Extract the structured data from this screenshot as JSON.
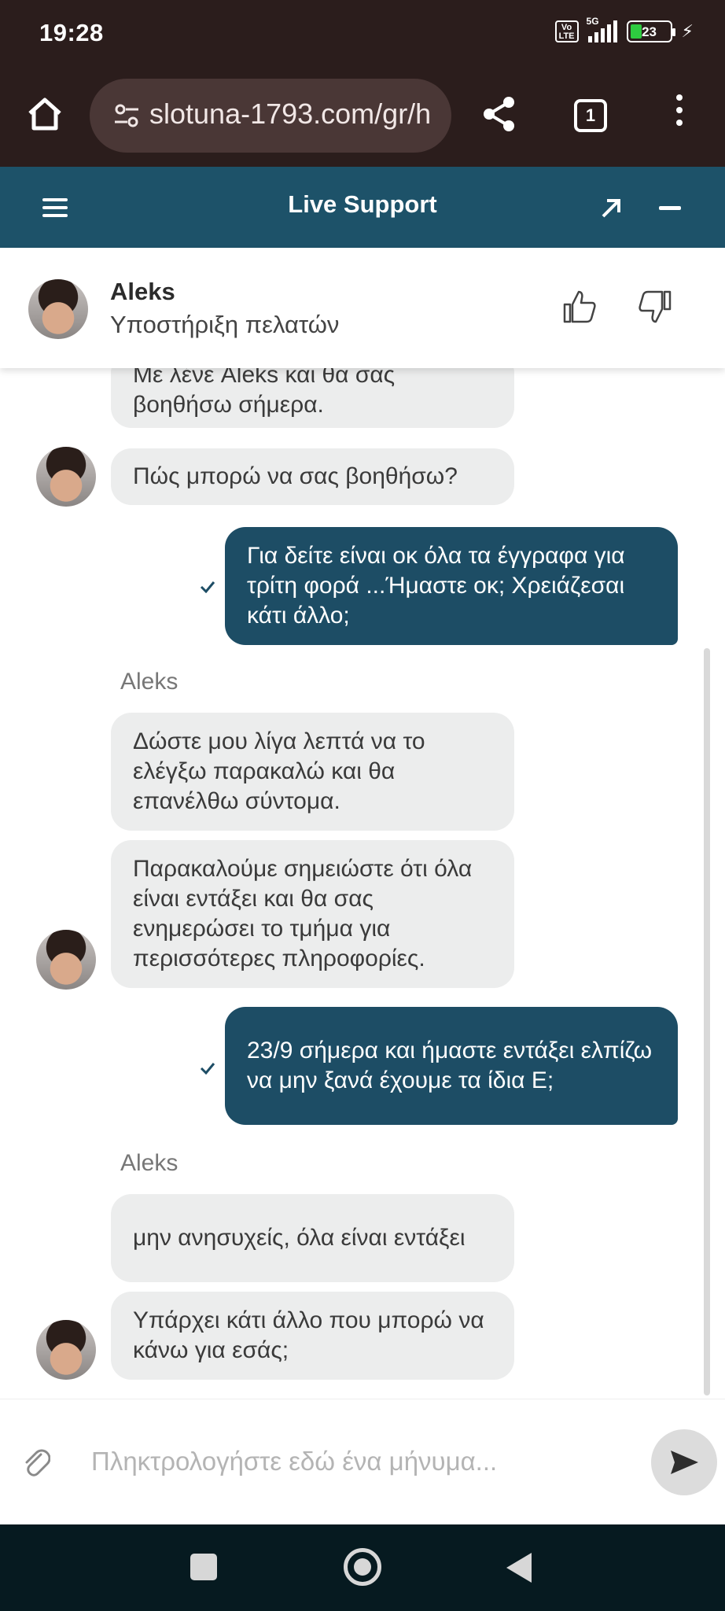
{
  "status_bar": {
    "time": "19:28",
    "volte": "Vo LTE",
    "network": "5G",
    "battery": "23"
  },
  "browser": {
    "url": "slotuna-1793.com/gr/h",
    "tab_count": "1"
  },
  "chat_header": {
    "title": "Live Support"
  },
  "agent": {
    "name": "Aleks",
    "role": "Υποστήριξη πελατών"
  },
  "messages": [
    {
      "from": "agent",
      "text": "Με λένε Aleks και θα σας βοηθήσω σήμερα."
    },
    {
      "from": "agent",
      "text": "Πώς μπορώ να σας βοηθήσω?"
    },
    {
      "from": "user",
      "text": "Για δείτε είναι οκ όλα τα έγγραφα για τρίτη φορά ...Ήμαστε οκ; Χρειάζεσαι κάτι άλλο;"
    },
    {
      "from": "agent",
      "sender": "Aleks",
      "text": "Δώστε μου λίγα λεπτά να το ελέγξω παρακαλώ και θα επανέλθω σύντομα."
    },
    {
      "from": "agent",
      "text": "Παρακαλούμε σημειώστε ότι όλα είναι εντάξει και θα σας ενημερώσει το τμήμα για περισσότερες πληροφορίες."
    },
    {
      "from": "user",
      "text": "23/9 σήμερα και ήμαστε εντάξει ελπίζω να μην ξανά έχουμε τα ίδια Ε;"
    },
    {
      "from": "agent",
      "sender": "Aleks",
      "text": "μην ανησυχείς, όλα είναι εντάξει"
    },
    {
      "from": "agent",
      "text": "Υπάρχει κάτι άλλο που μπορώ να κάνω για εσάς;"
    }
  ],
  "input": {
    "placeholder": "Πληκτρολογήστε εδώ ένα μήνυμα..."
  },
  "colors": {
    "header": "#1d5269",
    "user_bubble": "#1d4d65",
    "agent_bubble": "#eceded",
    "browser": "#2b1d1c"
  },
  "icons": [
    "home-icon",
    "tune-icon",
    "share-icon",
    "tabs-icon",
    "more-vert-icon",
    "hamburger-icon",
    "expand-icon",
    "minimize-icon",
    "thumb-up-icon",
    "thumb-down-icon",
    "check-icon",
    "attach-icon",
    "send-icon"
  ]
}
